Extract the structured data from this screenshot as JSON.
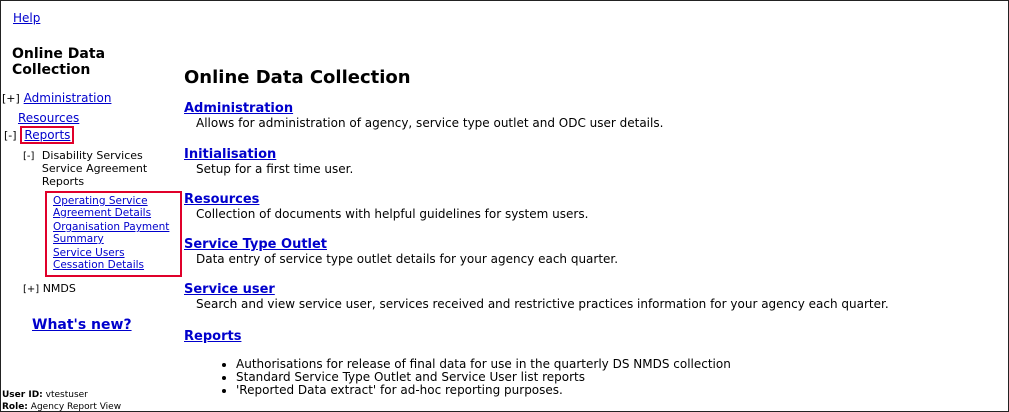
{
  "sidebar": {
    "help": "Help",
    "title_line1": "Online Data",
    "title_line2": "Collection",
    "items": [
      {
        "toggle": "[+]",
        "label": "Administration"
      },
      {
        "toggle": "",
        "label": "Resources"
      },
      {
        "toggle": "[-]",
        "label": "Reports"
      }
    ],
    "sub_group": {
      "toggle": "[-]",
      "line1": "Disability Services",
      "line2": "Service Agreement",
      "line3": "Reports",
      "links": [
        {
          "line1": "Operating Service",
          "line2": "Agreement Details"
        },
        {
          "line1": "Organisation Payment",
          "line2": "Summary"
        },
        {
          "line1": "Service Users",
          "line2": "Cessation Details"
        }
      ]
    },
    "nmds": {
      "toggle": "[+]",
      "label": "NMDS"
    },
    "whats_new": "What's new?",
    "user_id_label": "User ID:",
    "user_id": "vtestuser",
    "role_label": "Role:",
    "role": "Agency Report View"
  },
  "main": {
    "title": "Online Data Collection",
    "sections": [
      {
        "label": "Administration",
        "desc": "Allows for administration of agency, service type outlet and ODC user details."
      },
      {
        "label": "Initialisation",
        "desc": "Setup for a first time user."
      },
      {
        "label": "Resources",
        "desc": "Collection of documents with helpful guidelines for system users."
      },
      {
        "label": "Service Type Outlet",
        "desc": "Data entry of service type outlet details for your agency each quarter."
      },
      {
        "label": "Service user",
        "desc": "Search and view service user, services received and restrictive practices information for your agency each quarter."
      },
      {
        "label": "Reports",
        "desc": ""
      }
    ],
    "report_bullets": [
      "Authorisations for release of final data for use in the quarterly DS NMDS collection",
      "Standard Service Type Outlet and Service User list reports",
      "'Reported Data extract' for ad-hoc reporting purposes."
    ]
  },
  "colors": {
    "link": "#0000cc",
    "highlight_border": "#e0002a"
  }
}
